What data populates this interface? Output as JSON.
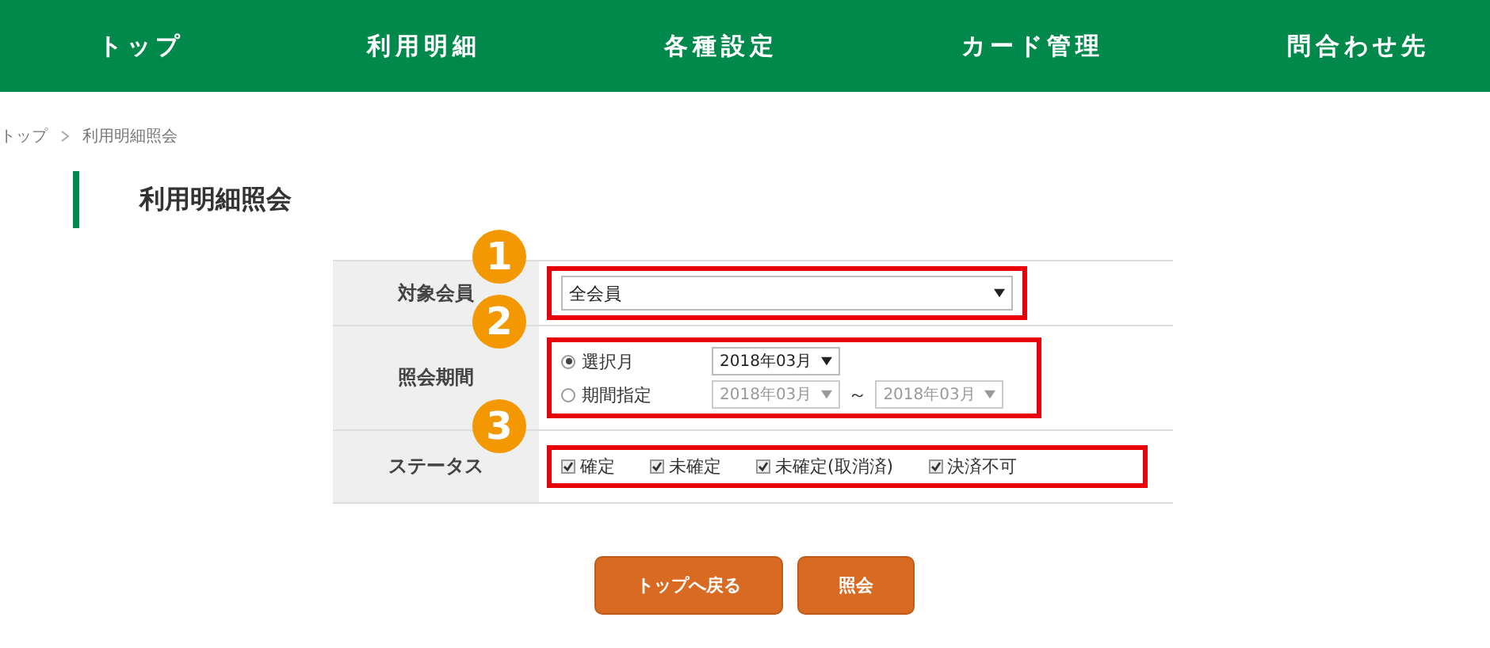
{
  "nav": [
    {
      "label": "トップ"
    },
    {
      "label": "利用明細"
    },
    {
      "label": "各種設定"
    },
    {
      "label": "カード管理"
    },
    {
      "label": "問合わせ先"
    }
  ],
  "breadcrumb": [
    {
      "label": "トップ"
    },
    {
      "label": "利用明細照会"
    }
  ],
  "title": "利用明細照会",
  "form": {
    "member": {
      "label": "対象会員",
      "callout": "1",
      "value": "全会員"
    },
    "period": {
      "label": "照会期間",
      "callout": "2",
      "options": [
        {
          "label": "選択月",
          "selected": true,
          "selects": [
            {
              "value": "2018年03月",
              "disabled": false
            }
          ]
        },
        {
          "label": "期間指定",
          "selected": false,
          "separator": "～",
          "selects": [
            {
              "value": "2018年03月",
              "disabled": true
            },
            {
              "value": "2018年03月",
              "disabled": true
            }
          ]
        }
      ]
    },
    "status": {
      "label": "ステータス",
      "callout": "3",
      "checks": [
        {
          "label": "確定",
          "checked": true
        },
        {
          "label": "未確定",
          "checked": true
        },
        {
          "label": "未確定(取消済)",
          "checked": true
        },
        {
          "label": "決済不可",
          "checked": true
        }
      ]
    }
  },
  "buttons": [
    {
      "label": "トップへ戻る"
    },
    {
      "label": "照会"
    }
  ]
}
